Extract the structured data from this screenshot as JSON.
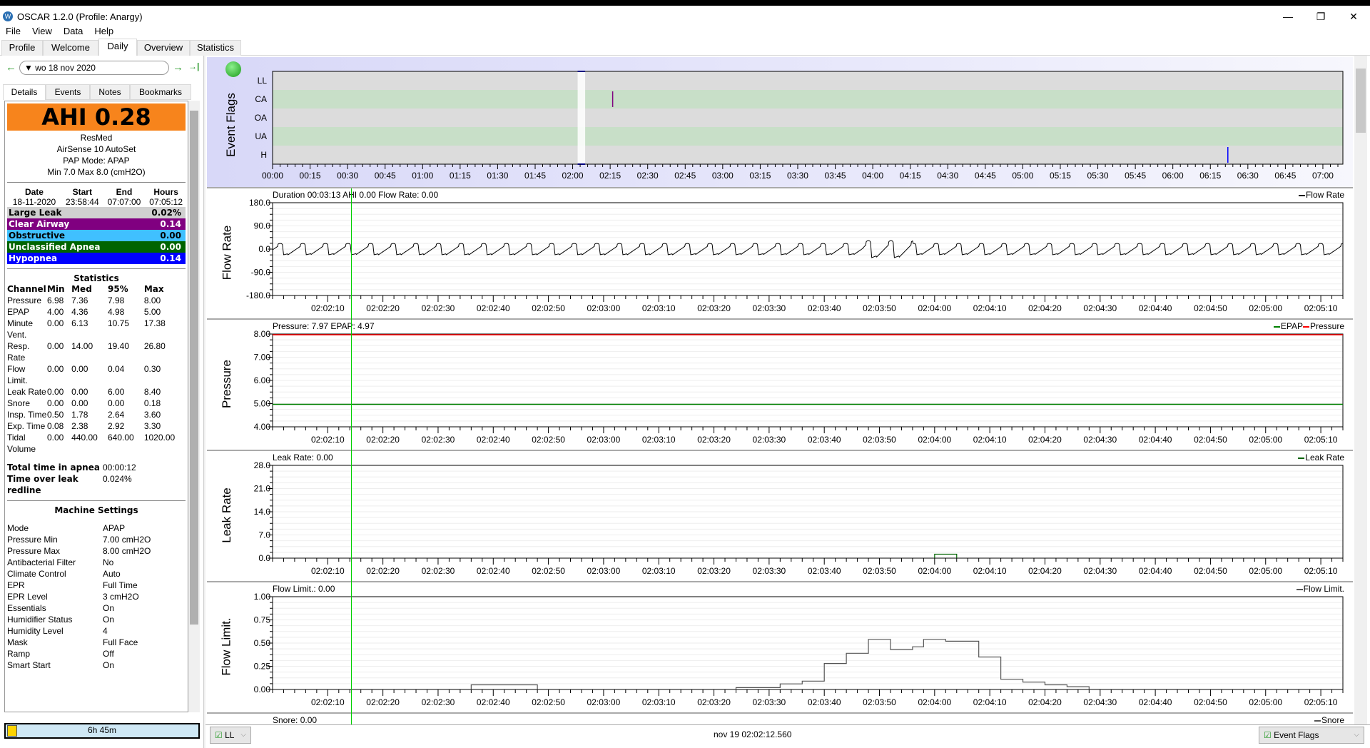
{
  "window": {
    "title": "OSCAR 1.2.0 (Profile: Anargy)",
    "minimize": "—",
    "restore": "❐",
    "close": "✕"
  },
  "menu": [
    "File",
    "View",
    "Data",
    "Help"
  ],
  "tabs": [
    {
      "label": "Profile",
      "active": false
    },
    {
      "label": "Welcome",
      "active": false
    },
    {
      "label": "Daily",
      "active": true
    },
    {
      "label": "Overview",
      "active": false
    },
    {
      "label": "Statistics",
      "active": false
    }
  ],
  "datenav": {
    "prev_icon": "←",
    "date": "wo 18 nov 2020",
    "dropdown_icon": "▼",
    "next_icon": "→",
    "last_icon": "→|"
  },
  "subtabs": [
    {
      "label": "Details",
      "active": true
    },
    {
      "label": "Events",
      "active": false
    },
    {
      "label": "Notes",
      "active": false
    },
    {
      "label": "Bookmarks",
      "active": false
    }
  ],
  "summary": {
    "ahi": "AHI 0.28",
    "ahi_color": "#f7841c",
    "brand": "ResMed",
    "model": "AirSense 10 AutoSet",
    "mode": "PAP Mode: APAP",
    "range": "Min 7.0 Max 8.0 (cmH2O)",
    "headers": [
      "Date",
      "Start",
      "End",
      "Hours"
    ],
    "values": [
      "18-11-2020",
      "23:58:44",
      "07:07:00",
      "07:05:12"
    ]
  },
  "events": [
    {
      "label": "Large Leak",
      "value": "0.02%",
      "bg": "#d0d0d0",
      "fg": "#000000"
    },
    {
      "label": "Clear Airway",
      "value": "0.14",
      "bg": "#800080",
      "fg": "#ffffff"
    },
    {
      "label": "Obstructive",
      "value": "0.00",
      "bg": "#40c0ff",
      "fg": "#000000"
    },
    {
      "label": "Unclassified Apnea",
      "value": "0.00",
      "bg": "#006400",
      "fg": "#ffffff"
    },
    {
      "label": "Hypopnea",
      "value": "0.14",
      "bg": "#0000ff",
      "fg": "#ffffff"
    }
  ],
  "statistics": {
    "title": "Statistics",
    "headers": [
      "Channel",
      "Min",
      "Med",
      "95%",
      "Max"
    ],
    "rows": [
      [
        "Pressure",
        "6.98",
        "7.36",
        "7.98",
        "8.00"
      ],
      [
        "EPAP",
        "4.00",
        "4.36",
        "4.98",
        "5.00"
      ],
      [
        "Minute Vent.",
        "0.00",
        "6.13",
        "10.75",
        "17.38"
      ],
      [
        "Resp. Rate",
        "0.00",
        "14.00",
        "19.40",
        "26.80"
      ],
      [
        "Flow Limit.",
        "0.00",
        "0.00",
        "0.04",
        "0.30"
      ],
      [
        "Leak Rate",
        "0.00",
        "0.00",
        "6.00",
        "8.40"
      ],
      [
        "Snore",
        "0.00",
        "0.00",
        "0.00",
        "0.18"
      ],
      [
        "Insp. Time",
        "0.50",
        "1.78",
        "2.64",
        "3.60"
      ],
      [
        "Exp. Time",
        "0.08",
        "2.38",
        "2.92",
        "3.30"
      ],
      [
        "Tidal Volume",
        "0.00",
        "440.00",
        "640.00",
        "1020.00"
      ]
    ]
  },
  "totals": [
    {
      "label": "Total time in apnea",
      "value": "00:00:12"
    },
    {
      "label": "Time over leak redline",
      "value": "0.024%"
    }
  ],
  "machine_settings": {
    "title": "Machine Settings",
    "rows": [
      [
        "Mode",
        "APAP"
      ],
      [
        "Pressure Min",
        "7.00 cmH2O"
      ],
      [
        "Pressure Max",
        "8.00 cmH2O"
      ],
      [
        "Antibacterial Filter",
        "No"
      ],
      [
        "Climate Control",
        "Auto"
      ],
      [
        "EPR",
        "Full Time"
      ],
      [
        "EPR Level",
        "3 cmH2O"
      ],
      [
        "Essentials",
        "On"
      ],
      [
        "Humidifier Status",
        "On"
      ],
      [
        "Humidity Level",
        "4"
      ],
      [
        "Mask",
        "Full Face"
      ],
      [
        "Ramp",
        "Off"
      ],
      [
        "Smart Start",
        "On"
      ]
    ]
  },
  "duration_bar": {
    "label": "6h 45m",
    "progress": 0.05
  },
  "bottom": {
    "left_combo": "LL",
    "cursor_time": "nov 19 02:02:12.560",
    "right_combo": "Event Flags"
  },
  "chart_data": [
    {
      "type": "table",
      "name": "event_flags",
      "ylabel": "Event Flags",
      "rows": [
        "LL",
        "CA",
        "OA",
        "UA",
        "H"
      ],
      "xticks": [
        "00:00",
        "00:15",
        "00:30",
        "00:45",
        "01:00",
        "01:15",
        "01:30",
        "01:45",
        "02:00",
        "02:15",
        "02:30",
        "02:45",
        "03:00",
        "03:15",
        "03:30",
        "03:45",
        "04:00",
        "04:15",
        "04:30",
        "04:45",
        "05:00",
        "05:15",
        "05:30",
        "05:45",
        "06:00",
        "06:15",
        "06:30",
        "06:45",
        "07:00"
      ],
      "xrange_min": [
        0,
        428
      ],
      "events": [
        {
          "row": "CA",
          "minute": 136,
          "color": "#800080"
        },
        {
          "row": "H",
          "minute": 382,
          "color": "#0000ff"
        }
      ],
      "selection_min": [
        122,
        125
      ]
    },
    {
      "type": "line",
      "name": "flow_rate",
      "title": "Duration 00:03:13 AHI 0.00 Flow Rate: 0.00",
      "ylabel": "Flow Rate",
      "legend": [
        "Flow Rate"
      ],
      "yticks": [
        "180.0",
        "90.0",
        "0.0",
        "-90.0",
        "-180.0"
      ],
      "ylim": [
        -180,
        180
      ],
      "xticks": [
        "02:02:10",
        "02:02:20",
        "02:02:30",
        "02:02:40",
        "02:02:50",
        "02:03:00",
        "02:03:10",
        "02:03:20",
        "02:03:30",
        "02:03:40",
        "02:03:50",
        "02:04:00",
        "02:04:10",
        "02:04:20",
        "02:04:30",
        "02:04:40",
        "02:04:50",
        "02:05:00",
        "02:05:10"
      ],
      "breath_period_s": 4.1,
      "amplitude": [
        -22,
        22
      ],
      "series_color": "#000000"
    },
    {
      "type": "line",
      "name": "pressure",
      "title": "Pressure: 7.97 EPAP: 4.97",
      "ylabel": "Pressure",
      "legend": [
        "EPAP",
        "Pressure"
      ],
      "yticks": [
        "8.00",
        "7.00",
        "6.00",
        "5.00",
        "4.00"
      ],
      "ylim": [
        4,
        8
      ],
      "series": [
        {
          "name": "EPAP",
          "value": 4.97,
          "color": "#008000"
        },
        {
          "name": "Pressure",
          "value": 7.97,
          "color": "#ff0000"
        }
      ]
    },
    {
      "type": "line",
      "name": "leak_rate",
      "title": "Leak Rate: 0.00",
      "ylabel": "Leak Rate",
      "legend": [
        "Leak Rate"
      ],
      "yticks": [
        "28.0",
        "21.0",
        "14.0",
        "7.0",
        "0.0"
      ],
      "ylim": [
        0,
        28
      ],
      "series_color": "#006400",
      "steps": [
        {
          "t0": 120,
          "t1": 124,
          "v": 1.2
        }
      ]
    },
    {
      "type": "line",
      "name": "flow_limitation",
      "title": "Flow Limit.: 0.00",
      "ylabel": "Flow Limit.",
      "legend": [
        "Flow Limit."
      ],
      "yticks": [
        "1.00",
        "0.75",
        "0.50",
        "0.25",
        "0.00"
      ],
      "ylim": [
        0,
        1
      ],
      "series_color": "#555555",
      "steps": [
        {
          "t0": 36,
          "t1": 48,
          "v": 0.05
        },
        {
          "t0": 84,
          "t1": 92,
          "v": 0.02
        },
        {
          "t0": 92,
          "t1": 96,
          "v": 0.06
        },
        {
          "t0": 96,
          "t1": 100,
          "v": 0.09
        },
        {
          "t0": 100,
          "t1": 104,
          "v": 0.28
        },
        {
          "t0": 104,
          "t1": 108,
          "v": 0.39
        },
        {
          "t0": 108,
          "t1": 112,
          "v": 0.54
        },
        {
          "t0": 112,
          "t1": 116,
          "v": 0.43
        },
        {
          "t0": 116,
          "t1": 118,
          "v": 0.46
        },
        {
          "t0": 118,
          "t1": 122,
          "v": 0.54
        },
        {
          "t0": 122,
          "t1": 128,
          "v": 0.52
        },
        {
          "t0": 128,
          "t1": 132,
          "v": 0.35
        },
        {
          "t0": 132,
          "t1": 136,
          "v": 0.11
        },
        {
          "t0": 136,
          "t1": 140,
          "v": 0.08
        },
        {
          "t0": 140,
          "t1": 144,
          "v": 0.05
        },
        {
          "t0": 144,
          "t1": 148,
          "v": 0.03
        }
      ]
    },
    {
      "type": "line",
      "name": "snore",
      "title": "Snore: 0.00",
      "legend": [
        "Snore"
      ]
    }
  ],
  "zoom_xrange_s": [
    0,
    194
  ],
  "cursor_s": 14.2
}
